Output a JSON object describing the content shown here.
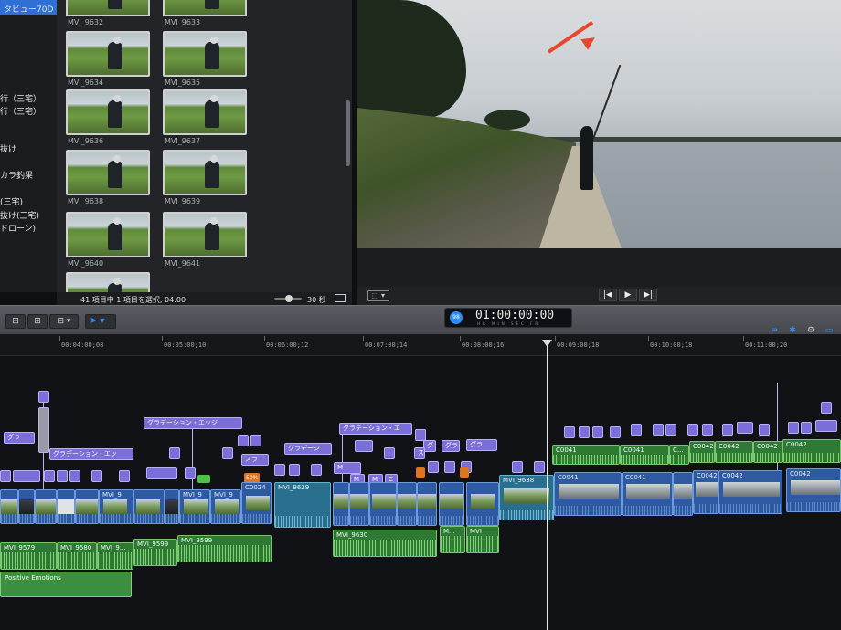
{
  "sidebar": {
    "selected": "タビュー70D",
    "items": [
      "行（三宅）",
      "行（三宅）",
      "抜け",
      "カラ釣果",
      "(三宅)",
      "抜け(三宅)",
      "ドローン)"
    ]
  },
  "browser": {
    "clips": [
      "MVI_9632",
      "MVI_9633",
      "MVI_9634",
      "MVI_9635",
      "MVI_9636",
      "MVI_9637",
      "MVI_9638",
      "MVI_9639",
      "MVI_9640",
      "MVI_9641"
    ],
    "status": "41 項目中 1 項目を選択, 04:00",
    "zoom_value": "30 秒"
  },
  "toolbar": {
    "timecode": "01:00:00:00",
    "timecode_units": "HR MIN SEC FR",
    "badge": "98"
  },
  "ruler": [
    "00:04:00;08",
    "00:05:00;10",
    "00:06:00;12",
    "00:07:00;14",
    "00:08:00;16",
    "00:09:00;18",
    "00:10:00;18",
    "00:11:00;20"
  ],
  "timeline": {
    "titles": {
      "t1": "グラ",
      "t2": "グラデーション・エッ",
      "t3": "グラデーション・エッジ",
      "t4": "グラデーシ",
      "t5": "グラデーション・エ",
      "t6": "スラ",
      "t7": "グ",
      "t8": "グラ",
      "t9": "ス",
      "t10": "M",
      "t11": "M",
      "t12": "M",
      "t13": "C",
      "t14": "グラ"
    },
    "badge_speed": "50%",
    "video": {
      "v1": "MVI_9",
      "v2": "MVI_9",
      "v3": "MVI_9",
      "v4": "C0024",
      "v5": "MVI_9629",
      "v6": "MVI_9638",
      "v7": "C0041",
      "v8": "C0041",
      "v9": "C0042",
      "v10": "C0042",
      "v11": "C0042"
    },
    "audio": {
      "a1": "MVI_9579",
      "a2": "MVI_9580",
      "a3": "MVI_9...",
      "a4": "MVI_9599",
      "a5": "MVI_9599",
      "a6": "MVI_9630",
      "a7": "M...",
      "a8": "MVI",
      "a9": "C0041",
      "a10": "C0041",
      "a11": "C...",
      "a12": "C0042",
      "a13": "C0042",
      "a14": "C0042",
      "a15": "C0042"
    },
    "music": "Positive Emotions"
  }
}
